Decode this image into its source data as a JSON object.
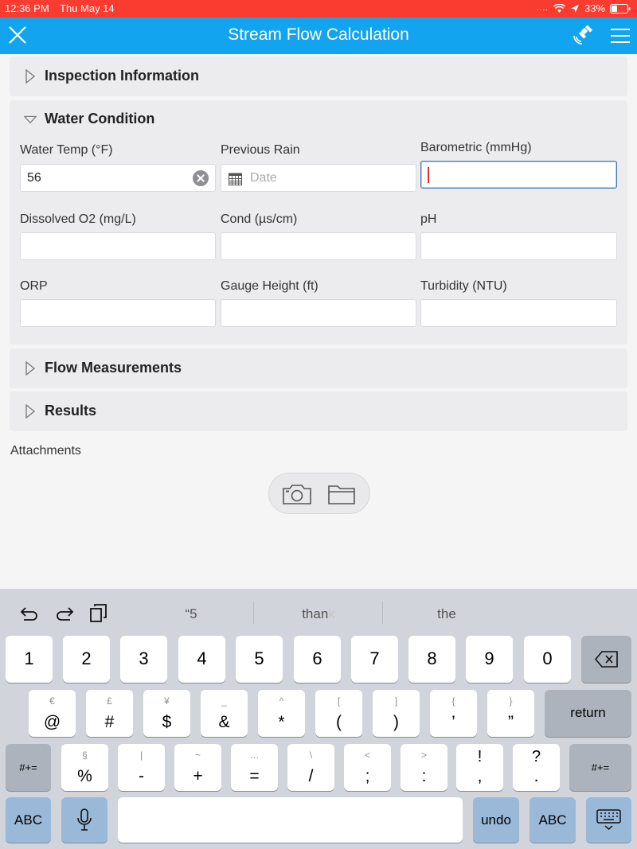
{
  "status_bar": {
    "time": "12:36 PM",
    "date": "Thu May 14",
    "signal": "....",
    "battery": "33%"
  },
  "nav": {
    "title": "Stream Flow Calculation",
    "close_icon": "close-icon",
    "gps_icon": "satellite-icon",
    "menu_icon": "hamburger-menu-icon"
  },
  "sections": {
    "inspection": {
      "label": "Inspection Information",
      "expanded": false
    },
    "water": {
      "label": "Water Condition",
      "expanded": true
    },
    "flow": {
      "label": "Flow Measurements",
      "expanded": false
    },
    "results": {
      "label": "Results",
      "expanded": false
    }
  },
  "water_fields": {
    "water_temp": {
      "label": "Water Temp (°F)",
      "value": "56"
    },
    "previous_rain": {
      "label": "Previous Rain",
      "placeholder": "Date"
    },
    "barometric": {
      "label": "Barometric (mmHg)",
      "value": ""
    },
    "dissolved_o2": {
      "label": "Dissolved O2 (mg/L)",
      "value": ""
    },
    "cond": {
      "label": "Cond (µs/cm)",
      "value": ""
    },
    "ph": {
      "label": "pH",
      "value": ""
    },
    "orp": {
      "label": "ORP",
      "value": ""
    },
    "gauge_height": {
      "label": "Gauge Height (ft)",
      "value": ""
    },
    "turbidity": {
      "label": "Turbidity (NTU)",
      "value": ""
    }
  },
  "attachments": {
    "label": "Attachments"
  },
  "keyboard": {
    "suggestions": [
      {
        "text": "“5",
        "fade": ""
      },
      {
        "text": "than",
        "fade": "k"
      },
      {
        "text": "the",
        "fade": ""
      }
    ],
    "row1": [
      "1",
      "2",
      "3",
      "4",
      "5",
      "6",
      "7",
      "8",
      "9",
      "0"
    ],
    "row2": [
      {
        "alt": "€",
        "main": "@"
      },
      {
        "alt": "£",
        "main": "#"
      },
      {
        "alt": "¥",
        "main": "$"
      },
      {
        "alt": "_",
        "main": "&"
      },
      {
        "alt": "^",
        "main": "*"
      },
      {
        "alt": "[",
        "main": "("
      },
      {
        "alt": "]",
        "main": ")"
      },
      {
        "alt": "{",
        "main": "’"
      },
      {
        "alt": "}",
        "main": "”"
      }
    ],
    "row3": [
      {
        "alt": "§",
        "main": "%"
      },
      {
        "alt": "|",
        "main": "-"
      },
      {
        "alt": "~",
        "main": "+"
      },
      {
        "alt": "…",
        "main": "="
      },
      {
        "alt": "\\",
        "main": "/"
      },
      {
        "alt": "<",
        "main": ";"
      },
      {
        "alt": ">",
        "main": ":"
      },
      {
        "alt": "!",
        "main": ","
      },
      {
        "alt": "?",
        "main": "."
      }
    ],
    "return_label": "return",
    "symbols_label": "#+=",
    "abc_label": "ABC",
    "undo_label": "undo"
  }
}
